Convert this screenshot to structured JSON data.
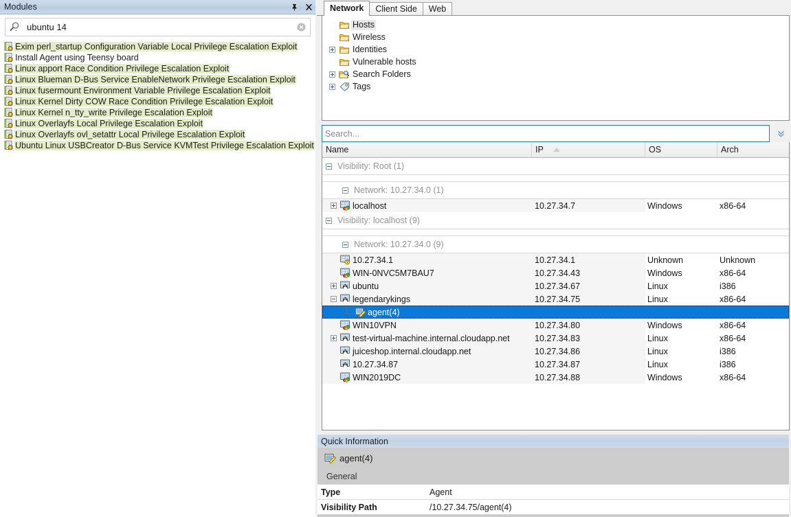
{
  "modules_panel": {
    "title": "Modules",
    "pin_tip": "Auto Hide",
    "close_tip": "Close",
    "search": {
      "value": "ubuntu 14",
      "placeholder": ""
    },
    "items": [
      {
        "label": "Exim perl_startup Configuration Variable Local Privilege Escalation Exploit",
        "highlight": true
      },
      {
        "label": "Install Agent using Teensy board",
        "highlight": false
      },
      {
        "label": "Linux apport Race Condition Privilege Escalation Exploit",
        "highlight": true
      },
      {
        "label": "Linux Blueman D-Bus Service EnableNetwork Privilege Escalation Exploit",
        "highlight": true
      },
      {
        "label": "Linux fusermount Environment Variable Privilege Escalation Exploit",
        "highlight": true
      },
      {
        "label": "Linux Kernel Dirty COW Race Condition Privilege Escalation Exploit",
        "highlight": true
      },
      {
        "label": "Linux Kernel n_tty_write Privilege Escalation Exploit",
        "highlight": true
      },
      {
        "label": "Linux Overlayfs Local Privilege Escalation Exploit",
        "highlight": true
      },
      {
        "label": "Linux Overlayfs ovl_setattr Local Privilege Escalation Exploit",
        "highlight": true
      },
      {
        "label": "Ubuntu Linux USBCreator D-Bus Service KVMTest Privilege Escalation Exploit",
        "highlight": true
      }
    ]
  },
  "tabs": [
    {
      "label": "Network",
      "active": true
    },
    {
      "label": "Client Side",
      "active": false
    },
    {
      "label": "Web",
      "active": false
    }
  ],
  "tree": [
    {
      "label": "Hosts",
      "icon": "folder-icon",
      "expander": "none",
      "selected": true
    },
    {
      "label": "Wireless",
      "icon": "folder-icon",
      "expander": "none",
      "selected": false
    },
    {
      "label": "Identities",
      "icon": "folder-icon",
      "expander": "plus",
      "selected": false
    },
    {
      "label": "Vulnerable hosts",
      "icon": "folder-icon",
      "expander": "none",
      "selected": false
    },
    {
      "label": "Search Folders",
      "icon": "search-folder-icon",
      "expander": "plus",
      "selected": false
    },
    {
      "label": "Tags",
      "icon": "tag-icon",
      "expander": "plus",
      "selected": false
    }
  ],
  "host_search": {
    "placeholder": "Search...",
    "value": ""
  },
  "table": {
    "columns": [
      "Name",
      "IP",
      "OS",
      "Arch"
    ],
    "sorted_column": "IP",
    "sort_direction": "asc",
    "groups": [
      {
        "label": "Visibility: Root (1)",
        "level": 1,
        "expander": "minus",
        "subgroups": [
          {
            "label": "Network: 10.27.34.0 (1)",
            "level": 2,
            "expander": "minus",
            "rows": [
              {
                "name": "localhost",
                "ip": "10.27.34.7",
                "os": "Windows",
                "arch": "x86-64",
                "expander": "plus",
                "icon": "windows-host-icon",
                "indent": 0,
                "selected": false
              }
            ]
          }
        ]
      },
      {
        "label": "Visibility: localhost (9)",
        "level": 1,
        "expander": "minus",
        "subgroups": [
          {
            "label": "Network: 10.27.34.0 (9)",
            "level": 2,
            "expander": "minus",
            "rows": [
              {
                "name": "10.27.34.1",
                "ip": "10.27.34.1",
                "os": "Unknown",
                "arch": "Unknown",
                "expander": "none",
                "icon": "unknown-host-icon",
                "indent": 0,
                "selected": false
              },
              {
                "name": "WIN-0NVC5M7BAU7",
                "ip": "10.27.34.43",
                "os": "Windows",
                "arch": "x86-64",
                "expander": "none",
                "icon": "windows-host-icon",
                "indent": 0,
                "selected": false
              },
              {
                "name": "ubuntu",
                "ip": "10.27.34.67",
                "os": "Linux",
                "arch": "i386",
                "expander": "plus",
                "icon": "linux-host-icon",
                "indent": 0,
                "selected": false
              },
              {
                "name": "legendarykings",
                "ip": "10.27.34.75",
                "os": "Linux",
                "arch": "x86-64",
                "expander": "minus",
                "icon": "linux-host-icon",
                "indent": 0,
                "selected": false
              },
              {
                "name": "agent(4)",
                "ip": "",
                "os": "",
                "arch": "",
                "expander": "none",
                "icon": "agent-icon",
                "indent": 1,
                "selected": true
              },
              {
                "name": "WIN10VPN",
                "ip": "10.27.34.80",
                "os": "Windows",
                "arch": "x86-64",
                "expander": "none",
                "icon": "windows-host-icon",
                "indent": 0,
                "selected": false
              },
              {
                "name": "test-virtual-machine.internal.cloudapp.net",
                "ip": "10.27.34.83",
                "os": "Linux",
                "arch": "x86-64",
                "expander": "plus",
                "icon": "linux-host-icon",
                "indent": 0,
                "selected": false
              },
              {
                "name": "juiceshop.internal.cloudapp.net",
                "ip": "10.27.34.86",
                "os": "Linux",
                "arch": "i386",
                "expander": "none",
                "icon": "linux-host-icon",
                "indent": 0,
                "selected": false
              },
              {
                "name": "10.27.34.87",
                "ip": "10.27.34.87",
                "os": "Linux",
                "arch": "i386",
                "expander": "none",
                "icon": "linux-host-icon",
                "indent": 0,
                "selected": false
              },
              {
                "name": "WIN2019DC",
                "ip": "10.27.34.88",
                "os": "Windows",
                "arch": "x86-64",
                "expander": "none",
                "icon": "windows-host-icon",
                "indent": 0,
                "selected": false
              }
            ]
          }
        ]
      }
    ]
  },
  "quick_information": {
    "title": "Quick Information",
    "entity": "agent(4)",
    "section": "General",
    "properties": [
      {
        "key": "Type",
        "value": "Agent"
      },
      {
        "key": "Visibility Path",
        "value": "/10.27.34.75/agent(4)"
      }
    ]
  },
  "colors": {
    "selection_blue": "#0b79d8",
    "module_highlight": "#e4ecc9",
    "titlebar_blue": "#c3d3e5",
    "search_focus_border": "#1e7bc8",
    "panel_gray": "#cccccc"
  }
}
